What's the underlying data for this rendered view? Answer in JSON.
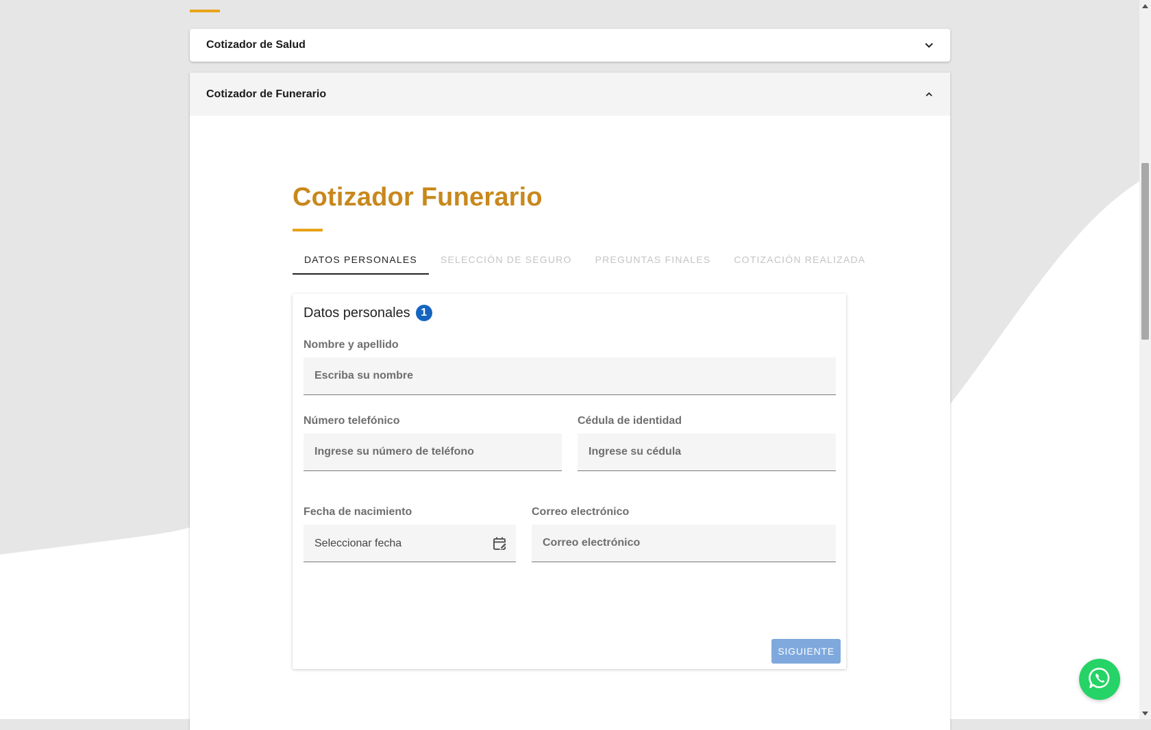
{
  "accordion": {
    "salud": {
      "title": "Cotizador de Salud",
      "expanded": false
    },
    "funerario": {
      "title": "Cotizador de Funerario",
      "expanded": true
    }
  },
  "quoter": {
    "title": "Cotizador Funerario",
    "tabs": [
      {
        "label": "Datos personales",
        "active": true
      },
      {
        "label": "Selección de seguro",
        "active": false
      },
      {
        "label": "Preguntas finales",
        "active": false
      },
      {
        "label": "Cotización realizada",
        "active": false
      }
    ],
    "form": {
      "title": "Datos personales",
      "step_number": "1",
      "name": {
        "label": "Nombre y apellido",
        "placeholder": "Escriba su nombre",
        "value": ""
      },
      "phone": {
        "label": "Número telefónico",
        "placeholder": "Ingrese su número de teléfono",
        "value": ""
      },
      "id_card": {
        "label": "Cédula de identidad",
        "placeholder": "Ingrese su cédula",
        "value": ""
      },
      "birthdate": {
        "label": "Fecha de nacimiento",
        "value": "Seleccionar fecha"
      },
      "email": {
        "label": "Correo electrónico",
        "placeholder": "Correo electrónico",
        "value": ""
      },
      "next_button": "Siguiente"
    }
  },
  "colors": {
    "accent": "#e8a317",
    "title": "#c8881c",
    "primary_button": "#7fa9dd",
    "badge": "#1565c0",
    "whatsapp": "#25d366"
  },
  "icons": {
    "salud_toggle": "chevron-down-icon",
    "funerario_toggle": "chevron-up-icon",
    "date_picker": "calendar-edit-icon",
    "chat": "whatsapp-icon"
  }
}
